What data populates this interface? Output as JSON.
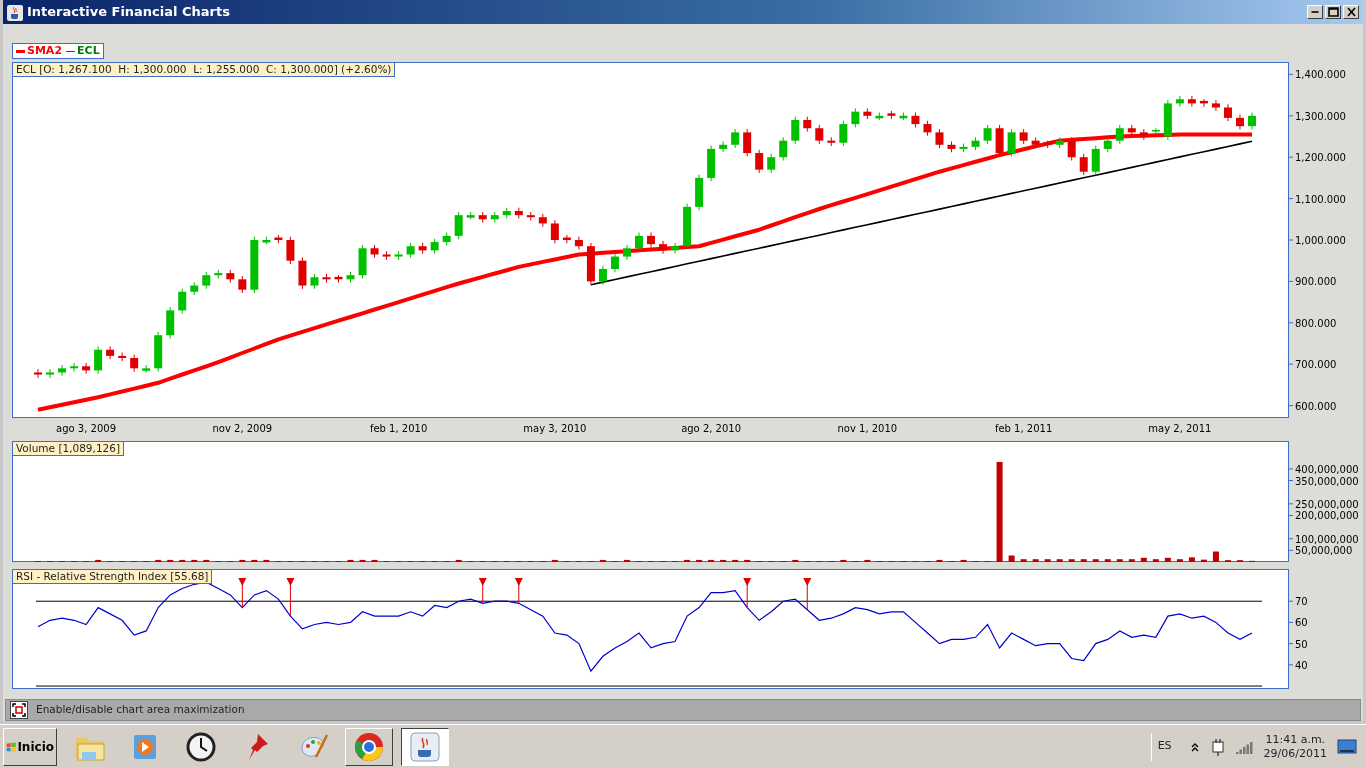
{
  "window": {
    "title": "Interactive Financial Charts"
  },
  "legend": [
    {
      "label": "ECL",
      "color": "#008000"
    }
  ],
  "price_panel": {
    "info": "ECL [O: 1,267.100  H: 1,300.000  L: 1,255.000  C: 1,300.000] (+2.60%)",
    "chart_data": {
      "type": "candlestick",
      "ylim": [
        570,
        1430
      ],
      "categories": [
        null,
        null,
        null,
        null,
        "ago 3, 2009",
        null,
        null,
        null,
        null,
        null,
        null,
        null,
        null,
        null,
        null,
        null,
        null,
        "nov 2, 2009",
        null,
        null,
        null,
        null,
        null,
        null,
        null,
        null,
        null,
        null,
        null,
        null,
        "feb 1, 2010",
        null,
        null,
        null,
        null,
        null,
        null,
        null,
        null,
        null,
        null,
        null,
        null,
        "may 3, 2010",
        null,
        null,
        null,
        null,
        null,
        null,
        null,
        null,
        null,
        null,
        null,
        null,
        "ago 2, 2010",
        null,
        null,
        null,
        null,
        null,
        null,
        null,
        null,
        null,
        null,
        null,
        null,
        "nov 1, 2010",
        null,
        null,
        null,
        null,
        null,
        null,
        null,
        null,
        null,
        null,
        null,
        null,
        "feb 1, 2011",
        null,
        null,
        null,
        null,
        null,
        null,
        null,
        null,
        null,
        null,
        null,
        null,
        "may 2, 2011",
        null,
        null,
        null,
        null,
        null,
        null
      ],
      "ohlc": [
        [
          680,
          688,
          667,
          675
        ],
        [
          675,
          688,
          667,
          680
        ],
        [
          680,
          698,
          672,
          690
        ],
        [
          690,
          703,
          682,
          695
        ],
        [
          695,
          703,
          677,
          685
        ],
        [
          685,
          743,
          677,
          735
        ],
        [
          735,
          743,
          712,
          720
        ],
        [
          720,
          728,
          707,
          715
        ],
        [
          715,
          723,
          682,
          690
        ],
        [
          684,
          698,
          680,
          690
        ],
        [
          690,
          778,
          682,
          770
        ],
        [
          770,
          838,
          762,
          830
        ],
        [
          830,
          883,
          822,
          875
        ],
        [
          875,
          898,
          867,
          890
        ],
        [
          890,
          923,
          882,
          915
        ],
        [
          915,
          928,
          907,
          920
        ],
        [
          920,
          928,
          897,
          905
        ],
        [
          905,
          913,
          872,
          880
        ],
        [
          880,
          1008,
          872,
          1000
        ],
        [
          994,
          1008,
          990,
          1000
        ],
        [
          1006,
          1012,
          992,
          1000
        ],
        [
          1000,
          1008,
          942,
          950
        ],
        [
          950,
          958,
          882,
          890
        ],
        [
          890,
          918,
          882,
          910
        ],
        [
          910,
          918,
          897,
          905
        ],
        [
          911,
          915,
          897,
          905
        ],
        [
          905,
          923,
          897,
          915
        ],
        [
          915,
          988,
          907,
          980
        ],
        [
          980,
          988,
          957,
          965
        ],
        [
          965,
          973,
          952,
          960
        ],
        [
          960,
          973,
          952,
          965
        ],
        [
          965,
          993,
          957,
          985
        ],
        [
          985,
          993,
          967,
          975
        ],
        [
          975,
          1003,
          967,
          995
        ],
        [
          995,
          1018,
          987,
          1010
        ],
        [
          1010,
          1068,
          1002,
          1060
        ],
        [
          1054,
          1068,
          1050,
          1060
        ],
        [
          1060,
          1068,
          1042,
          1050
        ],
        [
          1050,
          1068,
          1042,
          1060
        ],
        [
          1060,
          1078,
          1052,
          1070
        ],
        [
          1070,
          1078,
          1052,
          1060
        ],
        [
          1060,
          1068,
          1047,
          1055
        ],
        [
          1055,
          1063,
          1032,
          1040
        ],
        [
          1040,
          1048,
          992,
          1000
        ],
        [
          1006,
          1012,
          992,
          1000
        ],
        [
          1000,
          1008,
          977,
          985
        ],
        [
          985,
          993,
          892,
          900
        ],
        [
          900,
          938,
          892,
          930
        ],
        [
          930,
          968,
          922,
          960
        ],
        [
          960,
          988,
          952,
          980
        ],
        [
          980,
          1018,
          979,
          1010
        ],
        [
          1010,
          1018,
          982,
          990
        ],
        [
          990,
          998,
          967,
          975
        ],
        [
          975,
          993,
          967,
          985
        ],
        [
          985,
          1088,
          984,
          1080
        ],
        [
          1080,
          1158,
          1072,
          1150
        ],
        [
          1150,
          1228,
          1142,
          1220
        ],
        [
          1220,
          1238,
          1212,
          1230
        ],
        [
          1230,
          1268,
          1222,
          1260
        ],
        [
          1260,
          1268,
          1202,
          1210
        ],
        [
          1210,
          1218,
          1162,
          1170
        ],
        [
          1170,
          1208,
          1162,
          1200
        ],
        [
          1200,
          1248,
          1192,
          1240
        ],
        [
          1240,
          1298,
          1232,
          1290
        ],
        [
          1290,
          1298,
          1262,
          1270
        ],
        [
          1270,
          1278,
          1232,
          1240
        ],
        [
          1240,
          1248,
          1227,
          1235
        ],
        [
          1235,
          1288,
          1227,
          1280
        ],
        [
          1280,
          1318,
          1272,
          1310
        ],
        [
          1310,
          1318,
          1292,
          1300
        ],
        [
          1294,
          1308,
          1290,
          1300
        ],
        [
          1306,
          1312,
          1292,
          1300
        ],
        [
          1294,
          1308,
          1290,
          1300
        ],
        [
          1300,
          1308,
          1272,
          1280
        ],
        [
          1280,
          1288,
          1252,
          1260
        ],
        [
          1260,
          1268,
          1222,
          1230
        ],
        [
          1230,
          1238,
          1212,
          1220
        ],
        [
          1220,
          1233,
          1212,
          1225
        ],
        [
          1225,
          1248,
          1217,
          1240
        ],
        [
          1240,
          1278,
          1232,
          1270
        ],
        [
          1270,
          1278,
          1202,
          1210
        ],
        [
          1210,
          1268,
          1202,
          1260
        ],
        [
          1260,
          1268,
          1232,
          1240
        ],
        [
          1240,
          1248,
          1222,
          1230
        ],
        [
          1236,
          1240,
          1222,
          1230
        ],
        [
          1230,
          1248,
          1222,
          1240
        ],
        [
          1240,
          1248,
          1192,
          1200
        ],
        [
          1200,
          1208,
          1157,
          1165
        ],
        [
          1165,
          1228,
          1157,
          1220
        ],
        [
          1220,
          1248,
          1212,
          1240
        ],
        [
          1240,
          1278,
          1232,
          1270
        ],
        [
          1270,
          1278,
          1252,
          1260
        ],
        [
          1260,
          1268,
          1242,
          1250
        ],
        [
          1262,
          1270,
          1258,
          1266
        ],
        [
          1250,
          1338,
          1242,
          1330
        ],
        [
          1330,
          1348,
          1322,
          1340
        ],
        [
          1340,
          1348,
          1322,
          1330
        ],
        [
          1336,
          1340,
          1322,
          1330
        ],
        [
          1330,
          1338,
          1312,
          1320
        ],
        [
          1320,
          1328,
          1287,
          1295
        ],
        [
          1295,
          1303,
          1267,
          1275
        ],
        [
          1275,
          1308,
          1267,
          1300
        ]
      ],
      "series": [
        {
          "name": "SMA2",
          "type": "line",
          "color": "#ff0000",
          "values": [
            590,
            596,
            602,
            608,
            614,
            620,
            627,
            634,
            641,
            648,
            655,
            665,
            675,
            685,
            695,
            705,
            716,
            727,
            738,
            749,
            760,
            769,
            778,
            787,
            796,
            805,
            814,
            823,
            832,
            841,
            850,
            859,
            868,
            877,
            886,
            895,
            903,
            911,
            919,
            927,
            935,
            941,
            947,
            953,
            959,
            965,
            967,
            969,
            971,
            973,
            975,
            977,
            979,
            981,
            983,
            985,
            993,
            1001,
            1009,
            1017,
            1025,
            1035,
            1045,
            1055,
            1065,
            1075,
            1084,
            1093,
            1102,
            1111,
            1120,
            1129,
            1138,
            1147,
            1156,
            1165,
            1173,
            1181,
            1189,
            1197,
            1205,
            1212,
            1219,
            1226,
            1233,
            1240,
            1242,
            1244,
            1246,
            1248,
            1250,
            1251,
            1252,
            1253,
            1254,
            1255,
            1255,
            1255,
            1255,
            1255,
            1255,
            1255
          ]
        },
        {
          "type": "line",
          "color": "#000000",
          "values": [
            null,
            null,
            null,
            null,
            null,
            null,
            null,
            null,
            null,
            null,
            null,
            null,
            null,
            null,
            null,
            null,
            null,
            null,
            null,
            null,
            null,
            null,
            null,
            null,
            null,
            null,
            null,
            null,
            null,
            null,
            null,
            null,
            null,
            null,
            null,
            null,
            null,
            null,
            null,
            null,
            null,
            null,
            null,
            null,
            null,
            null,
            892,
            898.3,
            904.6,
            910.9,
            917.2,
            923.5,
            929.8,
            936.1,
            942.4,
            948.7,
            955,
            961.3,
            967.6,
            973.9,
            980.2,
            986.5,
            992.8,
            999.1,
            1005.4,
            1011.7,
            1018,
            1024.3,
            1030.6,
            1036.9,
            1043.2,
            1049.5,
            1055.8,
            1062.1,
            1068.4,
            1074.7,
            1081,
            1087.3,
            1093.6,
            1099.9,
            1106.2,
            1112.5,
            1118.8,
            1125.1,
            1131.4,
            1137.7,
            1144,
            1150.3,
            1156.6,
            1162.9,
            1169.2,
            1175.5,
            1181.8,
            1188.1,
            1194.4,
            1200.7,
            1207,
            1213.3,
            1219.6,
            1225.9,
            1232.2,
            1238.5
          ]
        }
      ],
      "yticks": [
        {
          "value": 1400,
          "label": "1,400.000"
        },
        {
          "value": 1300,
          "label": "1,300.000"
        },
        {
          "value": 1200,
          "label": "1,200.000"
        },
        {
          "value": 1100,
          "label": "1,100.000"
        },
        {
          "value": 1000,
          "label": "1,000.000"
        },
        {
          "value": 900,
          "label": "900.000"
        },
        {
          "value": 800,
          "label": "800.000"
        },
        {
          "value": 700,
          "label": "700.000"
        },
        {
          "value": 600,
          "label": "600.000"
        }
      ]
    }
  },
  "volume_panel": {
    "info": "[1,089,126]",
    "chart_data": {
      "type": "bar",
      "ylim": [
        0,
        520000000
      ],
      "categories": [
        null,
        null,
        null,
        null,
        null,
        null,
        null,
        null,
        null,
        null,
        null,
        null,
        null,
        null,
        null,
        null,
        null,
        null,
        null,
        null,
        null,
        null,
        null,
        null,
        null,
        null,
        null,
        null,
        null,
        null,
        null,
        null,
        null,
        null,
        null,
        null,
        null,
        null,
        null,
        null,
        null,
        null,
        null,
        null,
        null,
        null,
        null,
        null,
        null,
        null,
        null,
        null,
        null,
        null,
        null,
        null,
        null,
        null,
        null,
        null,
        null,
        null,
        null,
        null,
        null,
        null,
        null,
        null,
        null,
        null,
        null,
        null,
        null,
        null,
        null,
        null,
        null,
        null,
        null,
        null,
        null,
        null,
        null,
        null,
        null,
        null,
        null,
        null,
        null,
        null,
        null,
        null,
        null,
        null,
        null,
        null,
        null,
        null,
        null,
        null,
        null,
        null
      ],
      "series": [
        {
          "name": "Volume",
          "color": "#c00000",
          "values": [
            4000000,
            4000000,
            4000000,
            4000000,
            4000000,
            9000000,
            4000000,
            4000000,
            4000000,
            4000000,
            9000000,
            9000000,
            9000000,
            9000000,
            9000000,
            4000000,
            4000000,
            9000000,
            9000000,
            9000000,
            4000000,
            4000000,
            4000000,
            4000000,
            4000000,
            4000000,
            9000000,
            9000000,
            9000000,
            4000000,
            4000000,
            4000000,
            4000000,
            4000000,
            4000000,
            9000000,
            4000000,
            4000000,
            4000000,
            4000000,
            4000000,
            4000000,
            4000000,
            9000000,
            4000000,
            4000000,
            4000000,
            9000000,
            4000000,
            9000000,
            4000000,
            4000000,
            4000000,
            4000000,
            9000000,
            9000000,
            9000000,
            9000000,
            9000000,
            9000000,
            4000000,
            4000000,
            4000000,
            9000000,
            4000000,
            4000000,
            4000000,
            9000000,
            4000000,
            9000000,
            4000000,
            4000000,
            4000000,
            4000000,
            4000000,
            9000000,
            4000000,
            9000000,
            4000000,
            4000000,
            430000000,
            28000000,
            12000000,
            12000000,
            12000000,
            12000000,
            12000000,
            12000000,
            12000000,
            12000000,
            12000000,
            12000000,
            18000000,
            12000000,
            18000000,
            12000000,
            20000000,
            10000000,
            45000000,
            8000000,
            8000000,
            5000000
          ]
        }
      ],
      "yticks": [
        {
          "value": 400000000,
          "label": "400,000,000"
        },
        {
          "value": 350000000,
          "label": "350,000,000"
        },
        {
          "value": 250000000,
          "label": "250,000,000"
        },
        {
          "value": 200000000,
          "label": "200,000,000"
        },
        {
          "value": 100000000,
          "label": "100,000,000"
        },
        {
          "value": 50000000,
          "label": "50,000,000"
        }
      ]
    }
  },
  "rsi_panel": {
    "info": "- Relative Strength Index [55.68]",
    "chart_data": {
      "type": "line",
      "ylim": [
        28.6,
        85.2
      ],
      "series": [
        {
          "name": "RSI",
          "color": "#0000cc",
          "values": [
            58,
            61,
            62,
            61,
            59,
            67,
            64,
            61,
            54,
            56,
            67,
            73,
            76,
            78,
            79,
            76,
            73,
            67,
            73,
            75,
            71,
            63,
            57,
            59,
            60,
            59,
            60,
            65,
            63,
            63,
            63,
            65,
            63,
            68,
            67,
            70,
            71,
            69,
            70,
            70,
            69,
            66,
            63,
            55,
            54,
            50,
            37,
            44,
            48,
            51,
            55,
            48,
            50,
            51,
            63,
            67,
            74,
            74,
            75,
            67,
            61,
            65,
            70,
            71,
            66,
            61,
            62,
            64,
            67,
            66,
            64,
            65,
            65,
            60,
            55,
            50,
            52,
            52,
            53,
            59,
            48,
            55,
            52,
            49,
            50,
            50,
            43,
            42,
            50,
            52,
            56,
            53,
            54,
            53,
            63,
            64,
            62,
            63,
            60,
            55,
            52,
            55
          ]
        }
      ],
      "yticks": [
        70,
        60,
        50,
        40
      ]
    }
  },
  "status_bar": {
    "text": "Enable/disable chart area maximization"
  },
  "taskbar": {
    "start_label": "Inicio",
    "apps": [
      {
        "kind": "folder",
        "running": false,
        "selected": false
      },
      {
        "kind": "player",
        "running": false,
        "selected": false
      },
      {
        "kind": "clock",
        "running": false,
        "selected": false
      },
      {
        "kind": "pin",
        "running": false,
        "selected": false
      },
      {
        "kind": "palette",
        "running": false,
        "selected": false
      },
      {
        "kind": "globe",
        "running": true,
        "selected": false
      },
      {
        "kind": "cup",
        "running": true,
        "selected": true
      }
    ],
    "language": "ES",
    "time": "11:41 a.m.",
    "date": "29/06/2011"
  }
}
